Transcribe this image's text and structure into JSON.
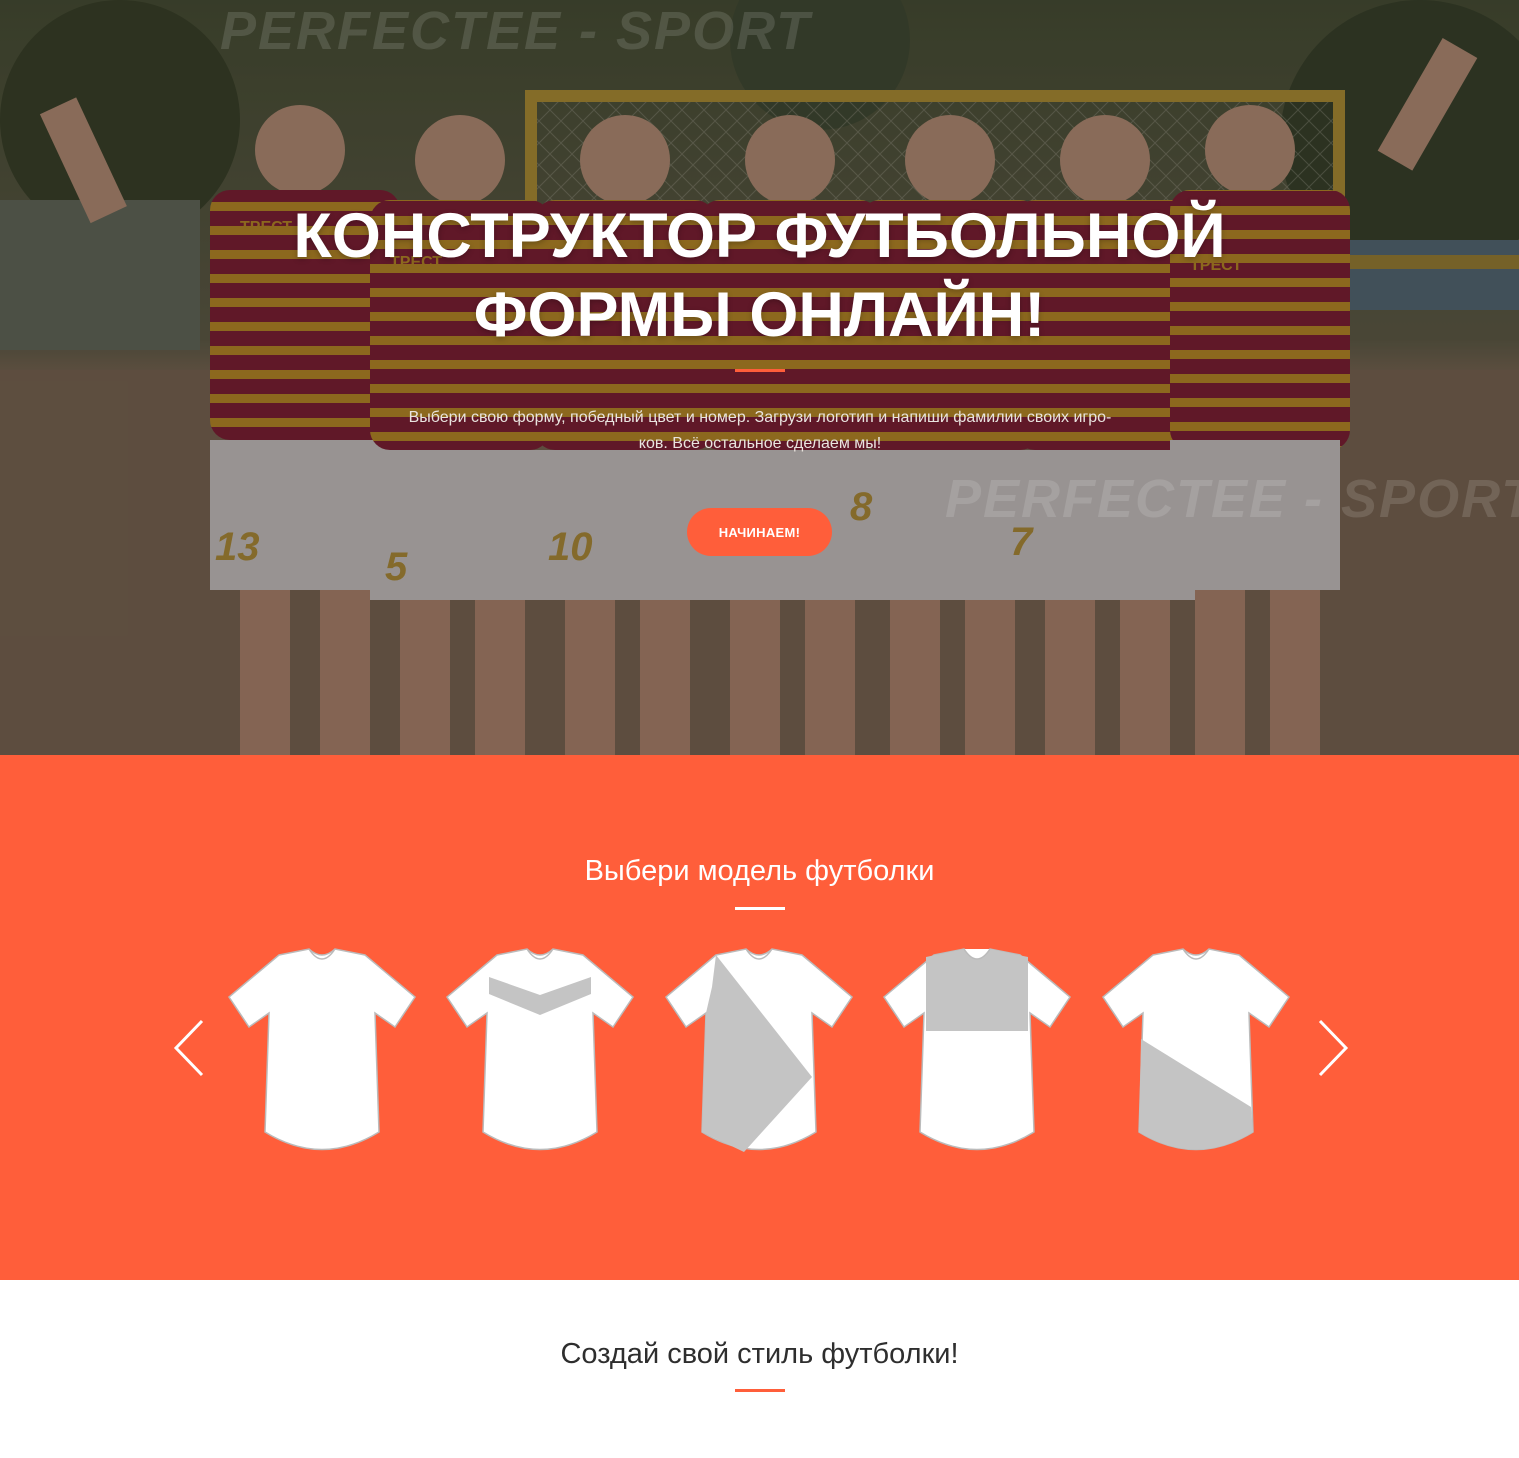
{
  "hero": {
    "watermark": "PERFECTEE - SPORT",
    "title_lines": [
      "КОНСТРУКТОР ФУТБОЛЬНОЙ",
      "ФОРМЫ ОНЛАЙН!"
    ],
    "subtitle_lines": [
      "Выбери свою форму, победный цвет и номер. Загрузи логотип и напиши фамилии своих игро-",
      "ков. Всё остальное сделаем мы!"
    ],
    "cta_label": "НАЧИНАЕМ!",
    "player_numbers": [
      "13",
      "5",
      "10",
      "8",
      "7"
    ],
    "jersey_text": "ТРЕСТ"
  },
  "models": {
    "title": "Выбери модель футболки",
    "prev_icon": "chevron-left-icon",
    "next_icon": "chevron-right-icon",
    "shirts": [
      {
        "name": "shirt-model-plain"
      },
      {
        "name": "shirt-model-chevron"
      },
      {
        "name": "shirt-model-diagonal-wedge"
      },
      {
        "name": "shirt-model-chest-panel"
      },
      {
        "name": "shirt-model-diagonal-bottom"
      }
    ]
  },
  "style": {
    "title": "Создай свой стиль футболки!"
  },
  "colors": {
    "accent": "#ff5e3a",
    "shirt_fill": "#ffffff",
    "shirt_pattern": "#c4c4c4",
    "hero_jersey_maroon": "#8e1f3b",
    "hero_jersey_gold": "#d6a12b"
  }
}
